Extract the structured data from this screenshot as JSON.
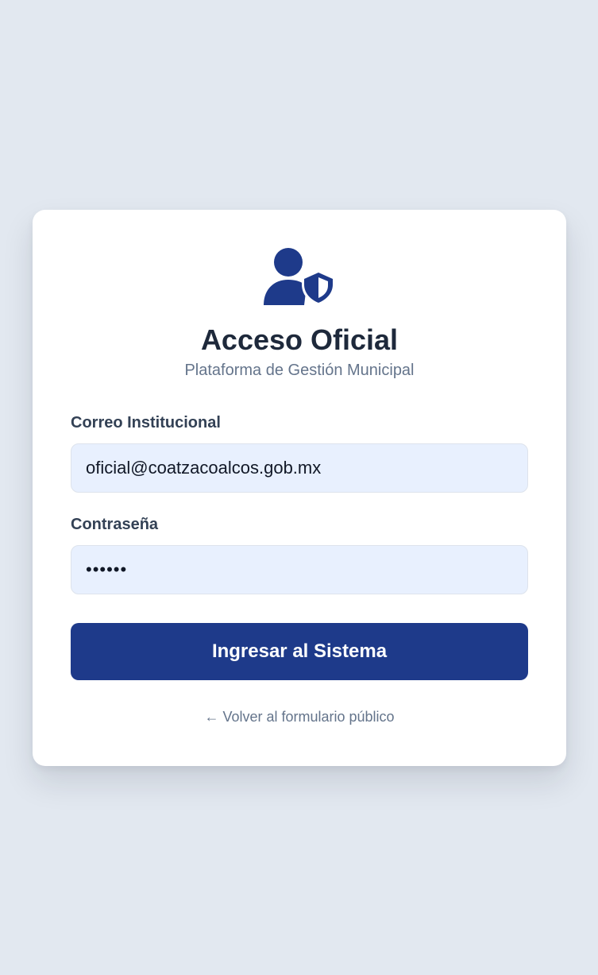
{
  "header": {
    "icon": "user-shield-icon",
    "title": "Acceso Oficial",
    "subtitle": "Plataforma de Gestión Municipal"
  },
  "form": {
    "email_label": "Correo Institucional",
    "email_value": "oficial@coatzacoalcos.gob.mx",
    "password_label": "Contraseña",
    "password_value": "123456",
    "submit_label": "Ingresar al Sistema"
  },
  "footer": {
    "back_link": "← Volver al formulario público"
  },
  "colors": {
    "page_background": "#e2e8f0",
    "card_background": "#ffffff",
    "accent": "#1e3a8a",
    "field_background": "#e8f0fe",
    "title_text": "#1e293b",
    "muted_text": "#64748b"
  }
}
